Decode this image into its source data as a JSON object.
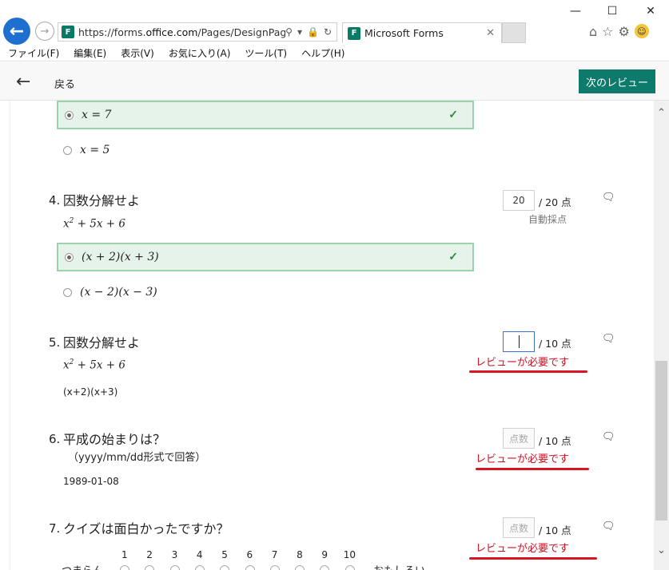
{
  "browser": {
    "url_prefix": "https://forms.",
    "url_domain": "office.com",
    "url_path": "/Pages/DesignPage.aspx",
    "tab_title": "Microsoft Forms",
    "fav_icon": "F",
    "menu": [
      "ファイル(F)",
      "編集(E)",
      "表示(V)",
      "お気に入り(A)",
      "ツール(T)",
      "ヘルプ(H)"
    ]
  },
  "header": {
    "back_label": "戻る",
    "next_label": "次のレビュー"
  },
  "prev_question": {
    "options": [
      {
        "text": "x = 7",
        "correct": true
      },
      {
        "text": "x = 5",
        "correct": false
      }
    ]
  },
  "questions": [
    {
      "number": "4.",
      "title": "因数分解せよ",
      "expr_base": "x",
      "expr_exp": "2",
      "expr_rest": " + 5x + 6",
      "score": "20",
      "score_of": "/ 20 点",
      "auto_label": "自動採点",
      "options": [
        {
          "text": "(x + 2)(x + 3)",
          "correct": true
        },
        {
          "text": "(x − 2)(x − 3)",
          "correct": false
        }
      ]
    },
    {
      "number": "5.",
      "title": "因数分解せよ",
      "expr_base": "x",
      "expr_exp": "2",
      "expr_rest": " + 5x + 6",
      "score": "",
      "score_of": "/ 10 点",
      "review_label": "レビューが必要です",
      "answer": "(x+2)(x+3)"
    },
    {
      "number": "6.",
      "title": "平成の始まりは？",
      "subtitle": "（yyyy/mm/dd形式で回答）",
      "score_placeholder": "点数",
      "score_of": "/ 10 点",
      "review_label": "レビューが必要です",
      "answer": "1989-01-08"
    },
    {
      "number": "7.",
      "title": "クイズは面白かったですか？",
      "score_placeholder": "点数",
      "score_of": "/ 10 点",
      "review_label": "レビューが必要です",
      "scale": [
        "1",
        "2",
        "3",
        "4",
        "5",
        "6",
        "7",
        "8",
        "9",
        "10"
      ],
      "scale_low": "つまらん",
      "scale_high": "おもしろい"
    }
  ],
  "colors": {
    "accent": "#0d7a6b",
    "correct_bg": "#e6f3ea",
    "correct_border": "#9dd2ac",
    "review_red": "#d10f1f"
  }
}
